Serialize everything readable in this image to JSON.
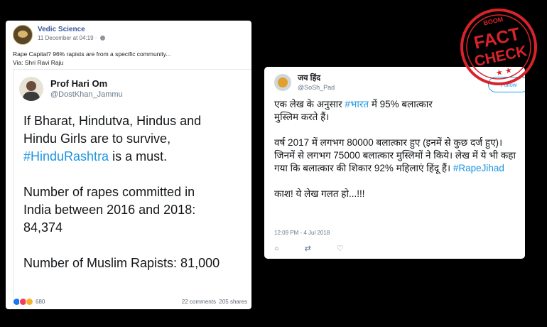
{
  "facebook_post": {
    "page_name": "Vedic Science",
    "timestamp": "11 December at 04:19 · ",
    "text_line1": "Rape Capital? 96% rapists are from a specific community...",
    "text_line2": "Via: Shri Ravi Raju",
    "embedded_tweet": {
      "name": "Prof Hari Om",
      "handle": "@DostKhan_Jammu",
      "para1_line1": "If Bharat, Hindutva, Hindus and",
      "para1_line2": "Hindu Girls are to survive,",
      "para1_hashtag": "#HinduRashtra",
      "para1_tail": " is a must.",
      "para2_line1": "Number of rapes committed in",
      "para2_line2": "India between 2016 and 2018:",
      "para2_line3": "84,374",
      "para3": "Number of Muslim Rapists: 81,000"
    },
    "reaction_count": "680",
    "comments": "22 comments",
    "shares": "205 shares"
  },
  "tweet": {
    "name": "जय हिंद",
    "handle": "@SoSh_Pad",
    "follow_label": "Follow",
    "p1_a": "एक लेख के अनुसार ",
    "p1_hashtag": "#भारत",
    "p1_b": " में 95% बलात्कार",
    "p1_c": "मुस्लिम करते हैं।",
    "p2_a": "वर्ष 2017 में लगभग 80000 बलात्कार हुए (इनमें से कुछ दर्ज हुए)। जिनमें से लगभग 75000 बलात्कार मुस्लिमों ने किये। लेख में ये भी कहा गया कि बलात्कार की शिकार 92% महिलाएं हिंदू हैं। ",
    "p2_hashtag": "#RapeJihad",
    "p3": "काश! ये लेख गलत हो...!!!",
    "time": "12:09 PM - 4 Jul 2018",
    "actions": {
      "reply_icon": "○",
      "retweet_icon": "⇄",
      "like_icon": "♡"
    }
  },
  "stamp": {
    "brand": "BOOM",
    "line1": "FACT",
    "line2": "CHECK",
    "stars": "★ ★",
    "color": "#d8232a"
  }
}
